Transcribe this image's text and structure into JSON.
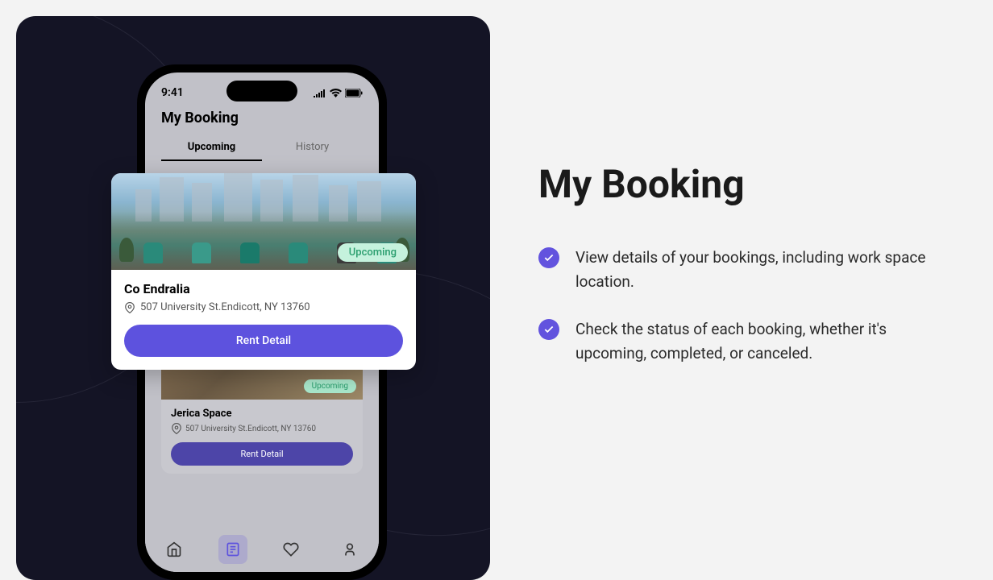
{
  "phone": {
    "time": "9:41",
    "screen_title": "My Booking",
    "tabs": {
      "upcoming": "Upcoming",
      "history": "History"
    },
    "card1": {
      "badge": "Upcoming",
      "title": "Co Endralia",
      "address": "507 University St.Endicott, NY 13760",
      "button": "Rent Detail"
    },
    "card2": {
      "badge": "Upcoming",
      "title": "Jerica Space",
      "address": "507 University St.Endicott, NY 13760",
      "button": "Rent Detail"
    }
  },
  "content": {
    "title": "My Booking",
    "features": [
      "View details of your bookings, including work space location.",
      "Check the status of each booking, whether it's upcoming, completed, or canceled."
    ]
  }
}
